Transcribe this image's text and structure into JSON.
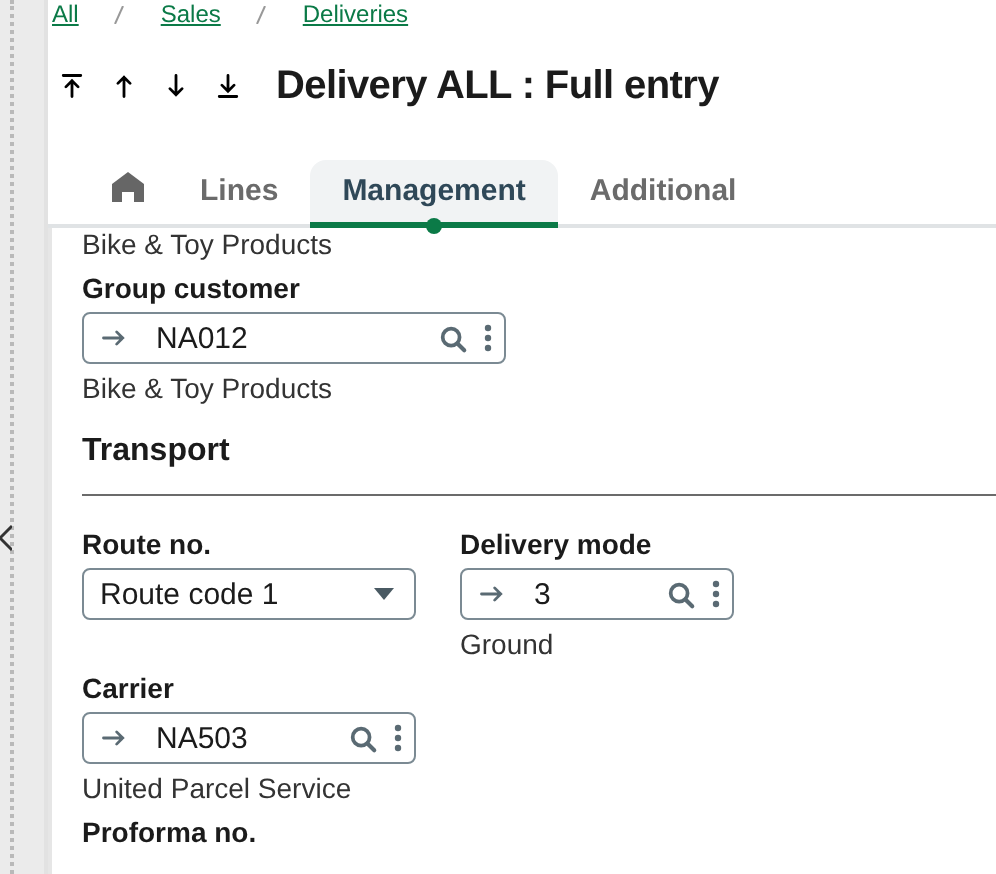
{
  "breadcrumb": [
    "All",
    "Sales",
    "Deliveries"
  ],
  "title": "Delivery ALL : Full entry",
  "nav_buttons": [
    {
      "kind": "first"
    },
    {
      "kind": "previous"
    },
    {
      "kind": "next"
    },
    {
      "kind": "last"
    }
  ],
  "tabs": [
    {
      "kind": "home",
      "selected": false
    },
    {
      "kind": "text",
      "label": "Lines",
      "selected": false
    },
    {
      "kind": "text",
      "label": "Management",
      "selected": true
    },
    {
      "kind": "text",
      "label": "Additional",
      "selected": false
    }
  ],
  "previous_text": "Bike & Toy Products",
  "group_customer": {
    "kind": "lookup",
    "label": "Group customer",
    "value": "NA012",
    "description": "Bike & Toy Products"
  },
  "transport": {
    "title": "Transport",
    "rows": [
      [
        {
          "kind": "select",
          "label": "Route no.",
          "value": "Route code 1"
        },
        {
          "kind": "lookup",
          "label": "Delivery mode",
          "value": "3",
          "description": "Ground"
        }
      ],
      [
        {
          "kind": "lookup",
          "label": "Carrier",
          "value": "NA503",
          "description": "United Parcel Service"
        }
      ],
      [
        {
          "kind": "label",
          "label": "Proforma no."
        }
      ]
    ]
  }
}
